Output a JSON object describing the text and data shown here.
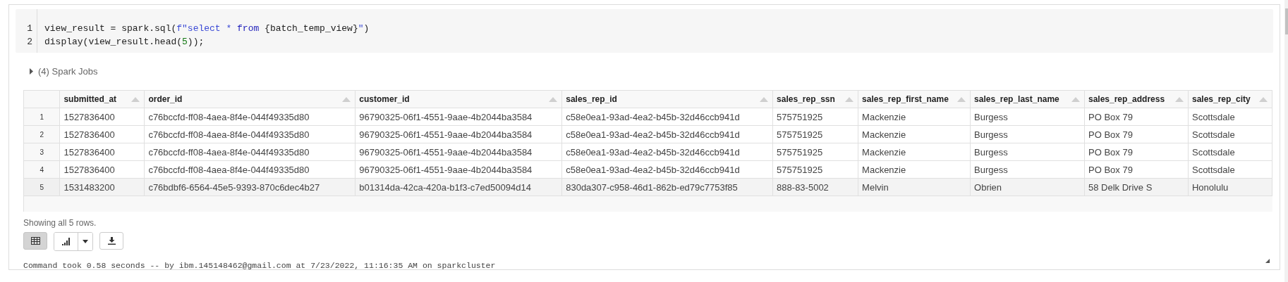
{
  "code": {
    "lines": [
      {
        "number": "1",
        "tokens": [
          {
            "kind": "plain",
            "text": "view_result = spark.sql("
          },
          {
            "kind": "string",
            "text": "f\"select * "
          },
          {
            "kind": "keyword",
            "text": "from"
          },
          {
            "kind": "plain",
            "text": " {batch_temp_view}"
          },
          {
            "kind": "string",
            "text": "\""
          },
          {
            "kind": "plain",
            "text": ")"
          }
        ]
      },
      {
        "number": "2",
        "tokens": [
          {
            "kind": "plain",
            "text": "display(view_result.head("
          },
          {
            "kind": "number",
            "text": "5"
          },
          {
            "kind": "plain",
            "text": "));"
          }
        ]
      }
    ]
  },
  "spark_jobs": {
    "label": "(4) Spark Jobs",
    "expanded": false
  },
  "table": {
    "columns": [
      "submitted_at",
      "order_id",
      "customer_id",
      "sales_rep_id",
      "sales_rep_ssn",
      "sales_rep_first_name",
      "sales_rep_last_name",
      "sales_rep_address",
      "sales_rep_city"
    ],
    "rows": [
      {
        "index": "1",
        "highlighted": false,
        "cells": [
          "1527836400",
          "c76bccfd-ff08-4aea-8f4e-044f49335d80",
          "96790325-06f1-4551-9aae-4b2044ba3584",
          "c58e0ea1-93ad-4ea2-b45b-32d46ccb941d",
          "575751925",
          "Mackenzie",
          "Burgess",
          "PO Box 79",
          "Scottsdale"
        ]
      },
      {
        "index": "2",
        "highlighted": false,
        "cells": [
          "1527836400",
          "c76bccfd-ff08-4aea-8f4e-044f49335d80",
          "96790325-06f1-4551-9aae-4b2044ba3584",
          "c58e0ea1-93ad-4ea2-b45b-32d46ccb941d",
          "575751925",
          "Mackenzie",
          "Burgess",
          "PO Box 79",
          "Scottsdale"
        ]
      },
      {
        "index": "3",
        "highlighted": false,
        "cells": [
          "1527836400",
          "c76bccfd-ff08-4aea-8f4e-044f49335d80",
          "96790325-06f1-4551-9aae-4b2044ba3584",
          "c58e0ea1-93ad-4ea2-b45b-32d46ccb941d",
          "575751925",
          "Mackenzie",
          "Burgess",
          "PO Box 79",
          "Scottsdale"
        ]
      },
      {
        "index": "4",
        "highlighted": false,
        "cells": [
          "1527836400",
          "c76bccfd-ff08-4aea-8f4e-044f49335d80",
          "96790325-06f1-4551-9aae-4b2044ba3584",
          "c58e0ea1-93ad-4ea2-b45b-32d46ccb941d",
          "575751925",
          "Mackenzie",
          "Burgess",
          "PO Box 79",
          "Scottsdale"
        ]
      },
      {
        "index": "5",
        "highlighted": true,
        "cells": [
          "1531483200",
          "c76bdbf6-6564-45e5-9393-870c6dec4b27",
          "b01314da-42ca-420a-b1f3-c7ed50094d14",
          "830da307-c958-46d1-862b-ed79c7753f85",
          "888-83-5002",
          "Melvin",
          "Obrien",
          "58 Delk Drive S",
          "Honolulu"
        ]
      }
    ]
  },
  "row_summary": "Showing all 5 rows.",
  "view_buttons": [
    {
      "kind": "table",
      "selected": true
    },
    {
      "kind": "chart",
      "selected": false
    }
  ],
  "status": "Command took 0.58 seconds -- by ibm.145148462@gmail.com at 7/23/2022, 11:16:35 AM on sparkcluster"
}
